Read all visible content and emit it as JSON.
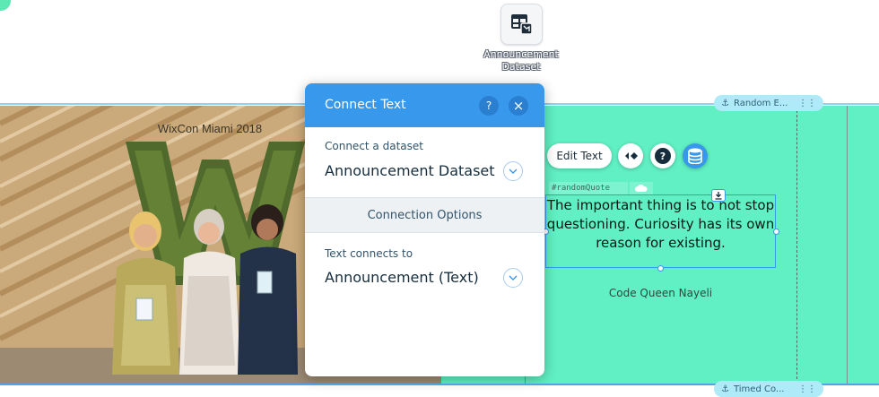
{
  "dataset_icon": {
    "label": "Announcement Dataset",
    "icon": "dataset-table-icon"
  },
  "photo": {
    "caption": "WixCon Miami 2018"
  },
  "anchors": {
    "top": "Random E...",
    "bottom": "Timed Co..."
  },
  "toolbar": {
    "edit_text": "Edit Text",
    "animation_icon": "animation-icon",
    "help_icon": "help-icon",
    "data_icon": "database-icon"
  },
  "element": {
    "id_tag": "#randomQuote",
    "quote": "The important thing is to not stop questioning. Curiosity has its own reason for existing.",
    "author": "Code Queen Nayeli"
  },
  "panel": {
    "title": "Connect Text",
    "help": "?",
    "close": "×",
    "dataset_label": "Connect a dataset",
    "dataset_value": "Announcement Dataset",
    "section": "Connection Options",
    "connects_label": "Text connects to",
    "connects_value": "Announcement (Text)"
  },
  "colors": {
    "accent": "#3899ec",
    "strip": "#60f0c3",
    "pill": "#aeeaf7"
  }
}
